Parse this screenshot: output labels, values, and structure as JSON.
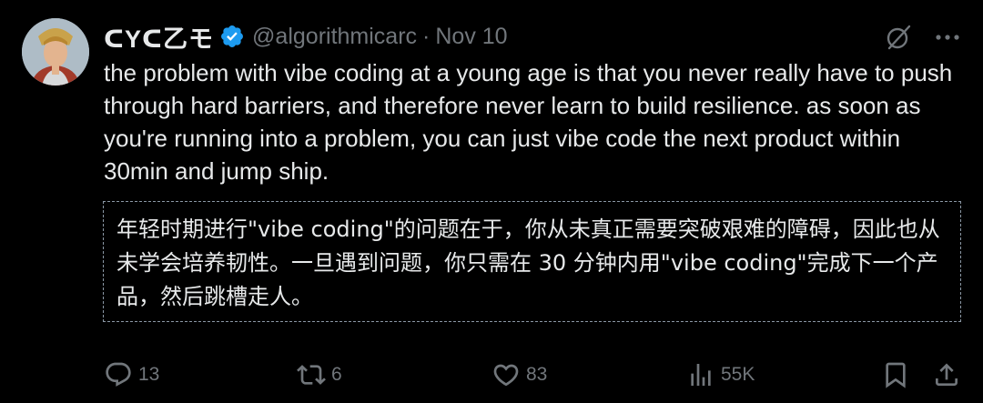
{
  "post": {
    "author": {
      "display_name": "ᑕYᑕ乙モ",
      "handle": "@algorithmicarc",
      "verified": true
    },
    "separator": "·",
    "timestamp": "Nov 10",
    "text": "the problem with vibe coding at a young age is that you never really have to push through hard barriers, and therefore never learn to build resilience. as soon as you're running into a problem, you can just vibe code the next product within 30min and jump ship.",
    "translation": "年轻时期进行\"vibe coding\"的问题在于，你从未真正需要突破艰难的障碍，因此也从未学会培养韧性。一旦遇到问题，你只需在 30 分钟内用\"vibe coding\"完成下一个产品，然后跳槽走人。"
  },
  "top_actions": {
    "grok_icon": "slash-circle-icon",
    "more_icon": "more-dots-icon"
  },
  "stats": {
    "replies": "13",
    "reposts": "6",
    "likes": "83",
    "views": "55K"
  },
  "colors": {
    "background": "#000000",
    "text": "#e7e9ea",
    "secondary": "#71767b",
    "verified": "#1d9bf0",
    "translation_border": "#8b98a5"
  }
}
